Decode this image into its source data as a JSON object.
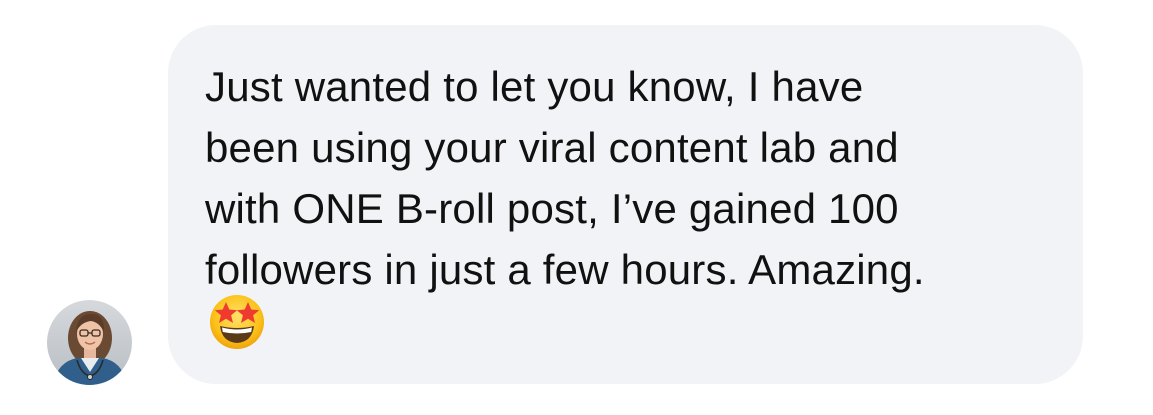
{
  "conversation": {
    "incoming_message": {
      "lines": [
        "Just wanted to let you know, I have",
        "been using your viral content lab and",
        "with ONE B-roll post, I’ve gained 100",
        "followers in just a few hours. Amazing."
      ],
      "emoji": "star-struck-emoji",
      "bubble_color": "#f2f3f6",
      "text_color": "#111111"
    },
    "sender": {
      "avatar": "profile-photo-avatar"
    }
  }
}
